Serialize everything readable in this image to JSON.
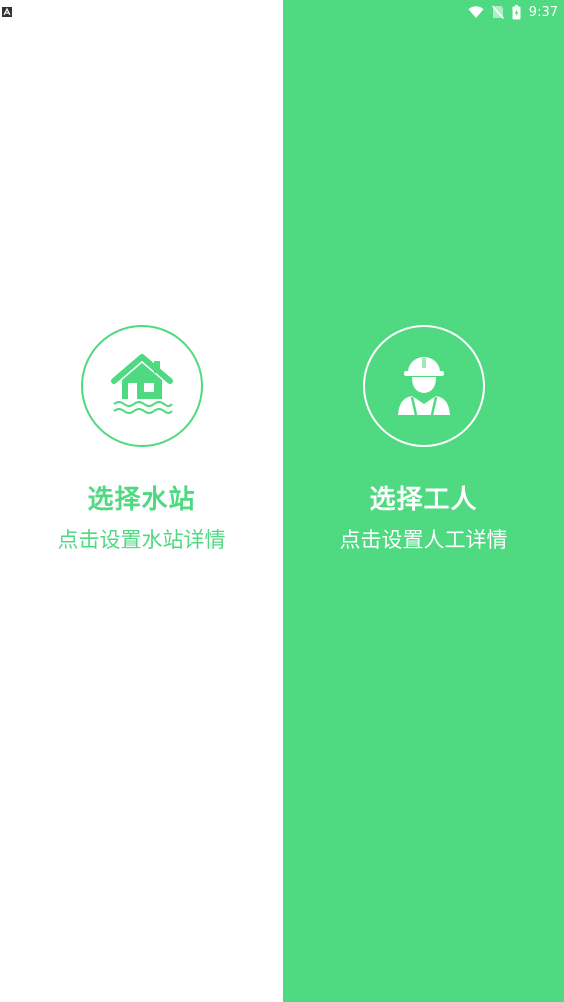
{
  "status_bar": {
    "time": "9:37",
    "icons": [
      "notification-a-icon",
      "wifi-icon",
      "no-sim-icon",
      "battery-icon"
    ]
  },
  "colors": {
    "accent": "#4fd981",
    "white": "#ffffff"
  },
  "left_panel": {
    "title": "选择水站",
    "subtitle": "点击设置水站详情",
    "icon": "house-water-icon"
  },
  "right_panel": {
    "title": "选择工人",
    "subtitle": "点击设置人工详情",
    "icon": "worker-icon"
  }
}
